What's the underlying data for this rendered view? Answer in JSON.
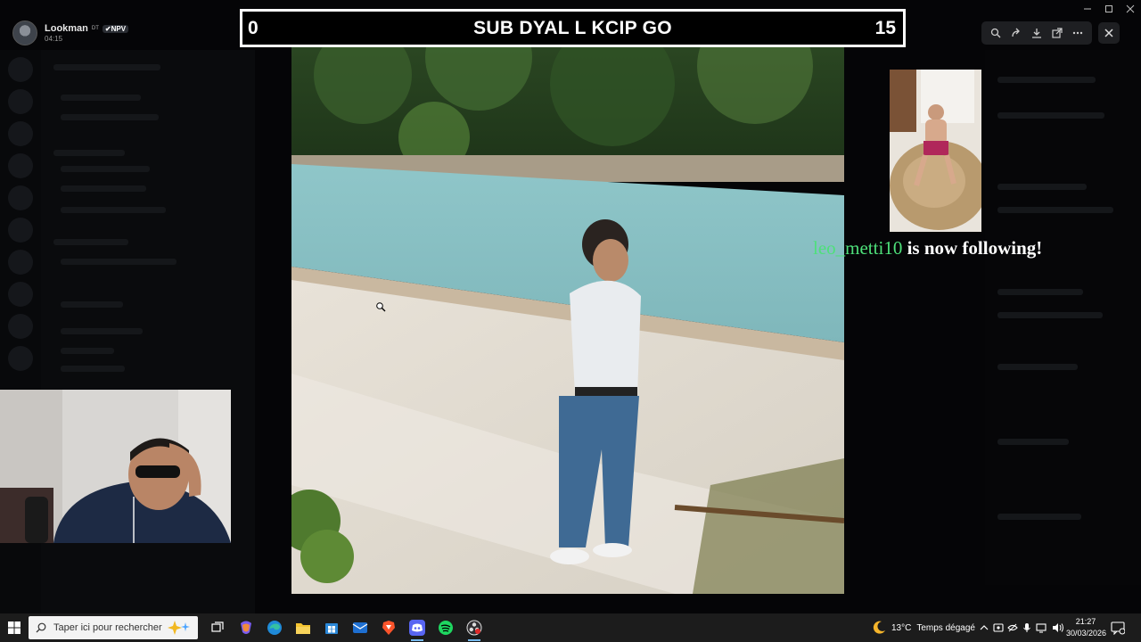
{
  "user": {
    "name": "Lookman",
    "tag": "DT",
    "badge": "✔NPV",
    "time": "04:15"
  },
  "score_bar": {
    "left_score": "0",
    "title": "SUB DYAL L KCIP GO",
    "right_score": "15"
  },
  "follow_alert": {
    "username": "leo_metti10",
    "message": "is now following!"
  },
  "taskbar": {
    "search_placeholder": "Taper ici pour rechercher",
    "weather_temp": "13°C",
    "weather_desc": "Temps dégagé",
    "clock_time": "21:27",
    "clock_date": "30/03/2026"
  },
  "colors": {
    "follow_name": "#4ee07a",
    "taskbar": "#1c1c1c",
    "score_border": "#ffffff"
  }
}
